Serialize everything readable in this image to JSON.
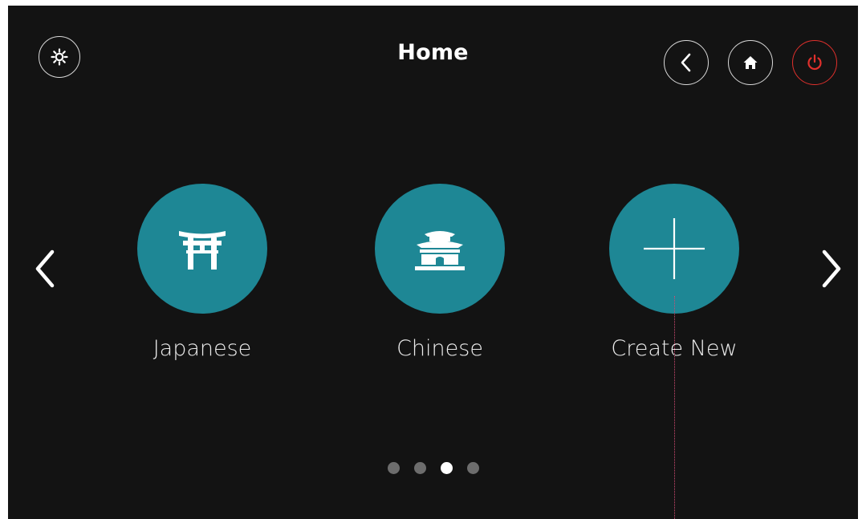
{
  "header": {
    "title": "Home"
  },
  "tiles": [
    {
      "label": "Japanese",
      "icon": "torii-gate-icon"
    },
    {
      "label": "Chinese",
      "icon": "chinese-temple-icon"
    },
    {
      "label": "Create New",
      "icon": "plus-icon"
    }
  ],
  "pagination": {
    "total": 4,
    "active_index": 2
  },
  "icons": {
    "settings": "gear-icon",
    "back": "chevron-left-icon",
    "home": "home-icon",
    "power": "power-icon",
    "prev": "chevron-left-icon",
    "next": "chevron-right-icon"
  },
  "colors": {
    "background": "#131313",
    "tile": "#1e8795",
    "power_accent": "#e0302c",
    "dot_inactive": "#6d6d6d",
    "dot_active": "#ffffff"
  }
}
